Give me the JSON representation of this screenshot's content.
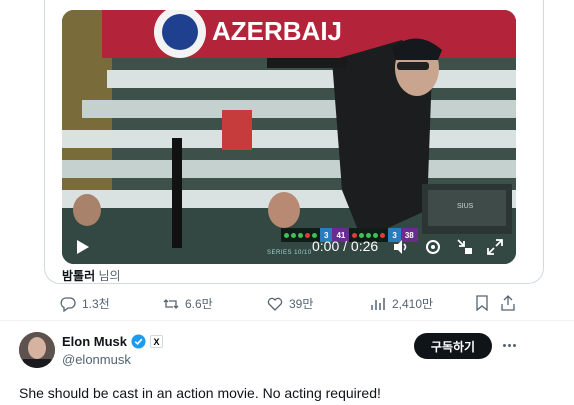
{
  "video": {
    "banner_text": "AZERBAIJ",
    "scoreboard": {
      "left_num": "3",
      "left_score": "41",
      "right_num": "3",
      "right_score": "38",
      "series": "SERIES 10/10"
    },
    "monitor_label": "SIUS",
    "time": "0:00 / 0:26"
  },
  "source": {
    "name": "밤톨러",
    "suffix": " 님의"
  },
  "actions": {
    "replies": "1.3천",
    "reposts": "6.6만",
    "likes": "39만",
    "views": "2,410만"
  },
  "author": {
    "name": "Elon Musk",
    "handle": "@elonmusk",
    "subscribe_label": "구독하기",
    "badge_letter": "X"
  },
  "tweet": {
    "text": "She should be cast in an action movie. No  acting required!"
  },
  "colors": {
    "verified": "#1d9bf0",
    "button": "#0f1419",
    "muted": "#536471"
  }
}
